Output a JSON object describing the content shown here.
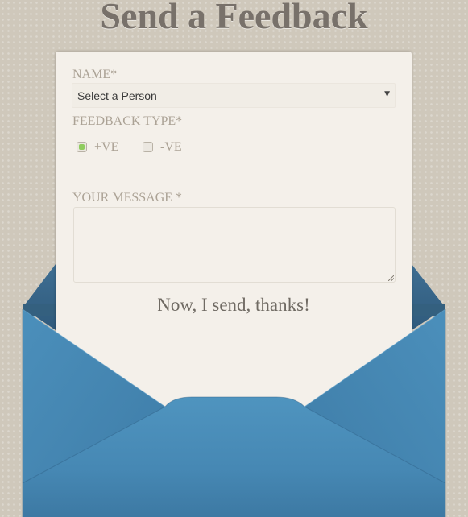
{
  "title": "Send a Feedback",
  "form": {
    "name_label": "NAME*",
    "person_select_value": "Select a Person",
    "feedback_type_label": "FEEDBACK TYPE*",
    "options": [
      {
        "label": "+VE",
        "checked": true
      },
      {
        "label": "-VE",
        "checked": false
      }
    ],
    "message_label": "YOUR MESSAGE *",
    "message_value": "",
    "submit_label": "Now, I send, thanks!"
  },
  "colors": {
    "background": "#cfc8bb",
    "paper": "#f4f0ea",
    "envelope_blue": "#4a8fba",
    "envelope_dark": "#3a6e92",
    "label_text": "#aba295",
    "checked_green": "#8fcc5f"
  },
  "icons": {
    "select_arrow": "dropdown-arrow-icon",
    "resize_grip": "resize-grip-icon"
  }
}
